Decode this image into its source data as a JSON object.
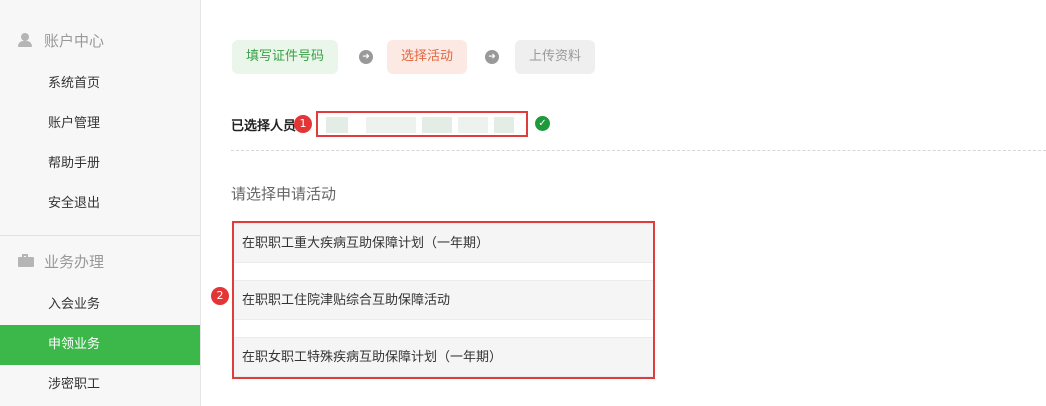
{
  "sidebar": {
    "account_title": "账户中心",
    "account_icon": "user-icon",
    "account_items": [
      "系统首页",
      "账户管理",
      "帮助手册",
      "安全退出"
    ],
    "business_title": "业务办理",
    "business_icon": "briefcase-icon",
    "business_items": [
      "入会业务",
      "申领业务",
      "涉密职工"
    ],
    "active_item": "申领业务",
    "active_color": "#3cb84a"
  },
  "steps": [
    "填写证件号码",
    "选择活动",
    "上传资料"
  ],
  "selected": {
    "label": "已选择人员",
    "badge": "1"
  },
  "prompt": "请选择申请活动",
  "activities": {
    "badge": "2",
    "items": [
      "在职职工重大疾病互助保障计划（一年期）",
      "在职职工住院津贴综合互助保障活动",
      "在职女职工特殊疾病互助保障计划（一年期）"
    ]
  },
  "highlight_color": "#e03c3c"
}
